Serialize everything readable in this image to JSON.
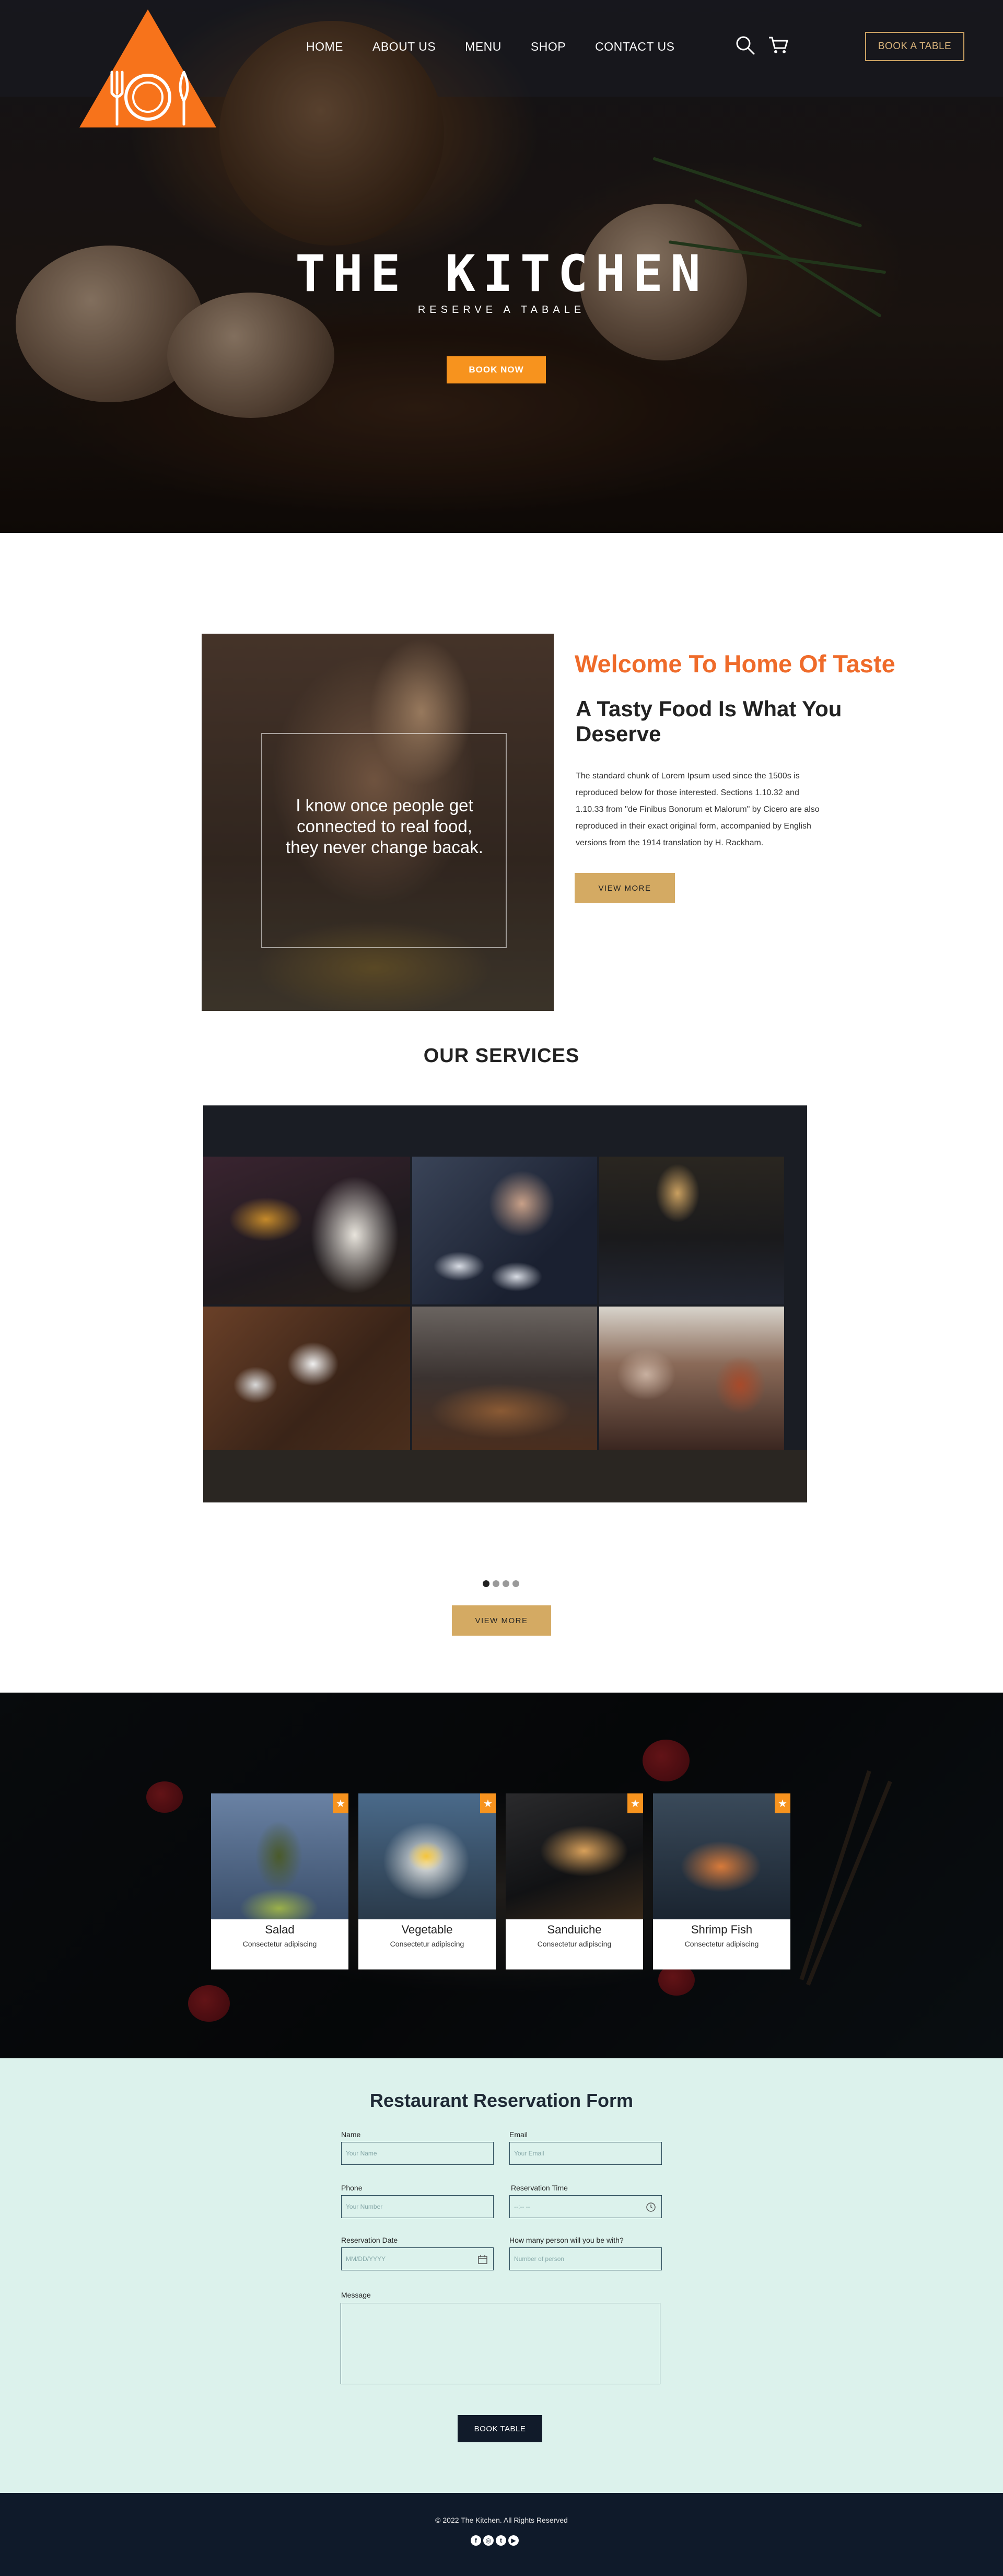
{
  "brand": {
    "logo_color": "#f7731b",
    "accent": "#f7931e",
    "gold": "#d4aa63",
    "welcome_color": "#ef6b2a"
  },
  "nav": {
    "items": [
      "HOME",
      "ABOUT US",
      "MENU",
      "SHOP",
      "CONTACT US"
    ],
    "search_icon": "search-icon",
    "cart_icon": "cart-icon",
    "book_table": "BOOK A TABLE"
  },
  "hero": {
    "title": "THE KITCHEN",
    "subtitle": "RESERVE A TABALE",
    "cta": "BOOK NOW"
  },
  "about": {
    "quote": "I know once people get connected to real food, they never change bacak.",
    "welcome": "Welcome To Home Of Taste",
    "heading": "A Tasty Food Is What You Deserve",
    "body": "The standard chunk of Lorem Ipsum used since the 1500s is reproduced below for those interested. Sections 1.10.32 and 1.10.33 from \"de Finibus Bonorum et Malorum\" by Cicero are also reproduced in their exact original form, accompanied by English versions from the 1914 translation by H. Rackham.",
    "cta": "VIEW MORE"
  },
  "services": {
    "title": "OUR SERVICES",
    "dots": 4,
    "active_dot": 0,
    "cta": "VIEW MORE"
  },
  "menu": {
    "items": [
      {
        "name": "Salad",
        "desc": "Consectetur adipiscing"
      },
      {
        "name": "Vegetable",
        "desc": "Consectetur adipiscing"
      },
      {
        "name": "Sanduiche",
        "desc": "Consectetur adipiscing"
      },
      {
        "name": "Shrimp Fish",
        "desc": "Consectetur adipiscing"
      }
    ],
    "badge_icon": "star-icon"
  },
  "reservation": {
    "title": "Restaurant Reservation Form",
    "name_label": "Name",
    "name_placeholder": "Your Name",
    "email_label": "Email",
    "email_placeholder": "Your Email",
    "phone_label": "Phone",
    "phone_placeholder": "Your Number",
    "time_label": "Reservation Time",
    "time_placeholder": "--:-- --",
    "date_label": "Reservation Date",
    "date_placeholder": "MM/DD/YYYY",
    "persons_label": "How many person will you be with?",
    "persons_placeholder": "Number of person",
    "message_label": "Message",
    "submit": "BOOK TABLE"
  },
  "footer": {
    "copyright": "© 2022 The Kitchen. All Rights Reserved",
    "social": [
      "facebook-icon",
      "instagram-icon",
      "twitter-icon",
      "youtube-icon"
    ]
  }
}
